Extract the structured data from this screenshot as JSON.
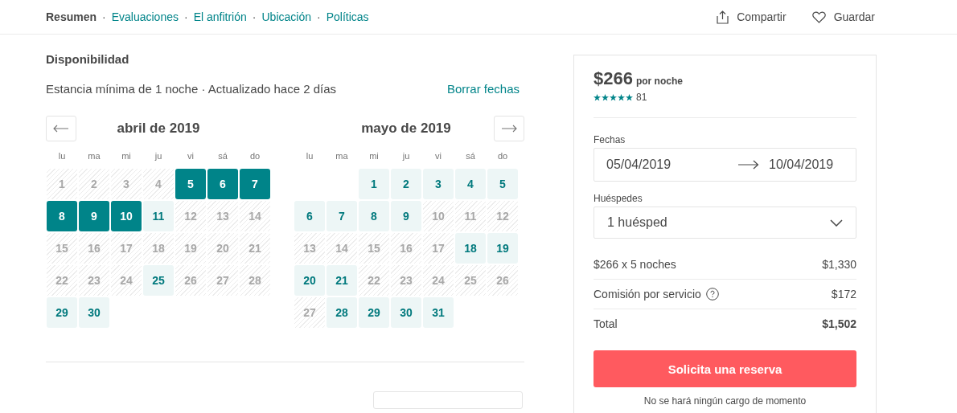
{
  "nav": {
    "items": [
      {
        "label": "Resumen",
        "selected": true
      },
      {
        "label": "Evaluaciones",
        "selected": false
      },
      {
        "label": "El anfitrión",
        "selected": false
      },
      {
        "label": "Ubicación",
        "selected": false
      },
      {
        "label": "Políticas",
        "selected": false
      }
    ],
    "separator": "·",
    "actions": [
      {
        "kind": "share",
        "label": "Compartir"
      },
      {
        "kind": "save",
        "label": "Guardar"
      }
    ]
  },
  "availability": {
    "title": "Disponibilidad",
    "subtitle": "Estancia mínima de 1 noche · Actualizado hace 2 días",
    "clear_link": "Borrar fechas",
    "months": [
      {
        "title": "abril de 2019",
        "kind": "previous",
        "weekdays": [
          "lu",
          "ma",
          "mi",
          "ju",
          "vi",
          "sá",
          "do"
        ],
        "days": [
          {
            "day": "1",
            "kind": "blocked"
          },
          {
            "day": "2",
            "kind": "blocked"
          },
          {
            "day": "3",
            "kind": "blocked"
          },
          {
            "day": "4",
            "kind": "blocked"
          },
          {
            "day": "5",
            "kind": "selected"
          },
          {
            "day": "6",
            "kind": "selected"
          },
          {
            "day": "7",
            "kind": "selected"
          },
          {
            "day": "8",
            "kind": "selected"
          },
          {
            "day": "9",
            "kind": "selected"
          },
          {
            "day": "10",
            "kind": "selected"
          },
          {
            "day": "11",
            "kind": "available"
          },
          {
            "day": "12",
            "kind": "blocked"
          },
          {
            "day": "13",
            "kind": "blocked"
          },
          {
            "day": "14",
            "kind": "blocked"
          },
          {
            "day": "15",
            "kind": "blocked"
          },
          {
            "day": "16",
            "kind": "blocked"
          },
          {
            "day": "17",
            "kind": "blocked"
          },
          {
            "day": "18",
            "kind": "blocked"
          },
          {
            "day": "19",
            "kind": "blocked"
          },
          {
            "day": "20",
            "kind": "blocked"
          },
          {
            "day": "21",
            "kind": "blocked"
          },
          {
            "day": "22",
            "kind": "blocked"
          },
          {
            "day": "23",
            "kind": "blocked"
          },
          {
            "day": "24",
            "kind": "blocked"
          },
          {
            "day": "25",
            "kind": "available"
          },
          {
            "day": "26",
            "kind": "blocked"
          },
          {
            "day": "27",
            "kind": "blocked"
          },
          {
            "day": "28",
            "kind": "blocked"
          },
          {
            "day": "29",
            "kind": "available"
          },
          {
            "day": "30",
            "kind": "available"
          }
        ]
      },
      {
        "title": "mayo de 2019",
        "kind": "next",
        "weekdays": [
          "lu",
          "ma",
          "mi",
          "ju",
          "vi",
          "sá",
          "do"
        ],
        "days": [
          {
            "kind": "empty"
          },
          {
            "kind": "empty"
          },
          {
            "day": "1",
            "kind": "available"
          },
          {
            "day": "2",
            "kind": "available"
          },
          {
            "day": "3",
            "kind": "available"
          },
          {
            "day": "4",
            "kind": "available"
          },
          {
            "day": "5",
            "kind": "available"
          },
          {
            "day": "6",
            "kind": "available"
          },
          {
            "day": "7",
            "kind": "available"
          },
          {
            "day": "8",
            "kind": "available"
          },
          {
            "day": "9",
            "kind": "available"
          },
          {
            "day": "10",
            "kind": "blocked"
          },
          {
            "day": "11",
            "kind": "blocked"
          },
          {
            "day": "12",
            "kind": "blocked"
          },
          {
            "day": "13",
            "kind": "blocked"
          },
          {
            "day": "14",
            "kind": "blocked"
          },
          {
            "day": "15",
            "kind": "blocked"
          },
          {
            "day": "16",
            "kind": "blocked"
          },
          {
            "day": "17",
            "kind": "blocked"
          },
          {
            "day": "18",
            "kind": "available"
          },
          {
            "day": "19",
            "kind": "available"
          },
          {
            "day": "20",
            "kind": "available"
          },
          {
            "day": "21",
            "kind": "available"
          },
          {
            "day": "22",
            "kind": "blocked"
          },
          {
            "day": "23",
            "kind": "blocked"
          },
          {
            "day": "24",
            "kind": "blocked"
          },
          {
            "day": "25",
            "kind": "blocked"
          },
          {
            "day": "26",
            "kind": "blocked"
          },
          {
            "day": "27",
            "kind": "blocked"
          },
          {
            "day": "28",
            "kind": "available"
          },
          {
            "day": "29",
            "kind": "available"
          },
          {
            "day": "30",
            "kind": "available"
          },
          {
            "day": "31",
            "kind": "available"
          }
        ]
      }
    ]
  },
  "booking": {
    "price": "$266",
    "price_unit": "por noche",
    "stars": 5,
    "reviews": "81",
    "dates_label": "Fechas",
    "check_in": "05/04/2019",
    "check_out": "10/04/2019",
    "guests_label": "Huéspedes",
    "guests": "1 huésped",
    "lines": [
      {
        "label": "$266 x 5 noches",
        "amount": "$1,330",
        "kind": "plain"
      },
      {
        "label": "Comisión por servicio",
        "amount": "$172",
        "kind": "info"
      },
      {
        "label": "Total",
        "amount": "$1,502",
        "kind": "total"
      }
    ],
    "button": "Solicita una reserva",
    "note": "No se hará ningún cargo de momento"
  }
}
